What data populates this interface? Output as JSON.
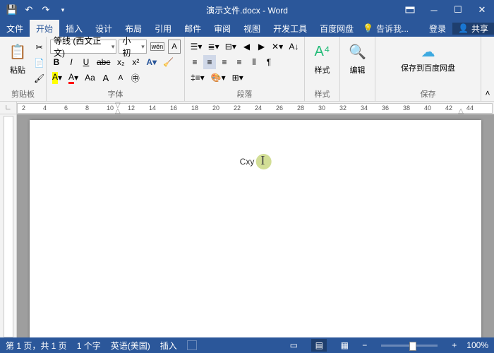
{
  "title": "演示文件.docx - Word",
  "tabs": {
    "file": "文件",
    "home": "开始",
    "insert": "插入",
    "design": "设计",
    "layout": "布局",
    "ref": "引用",
    "mail": "邮件",
    "review": "审阅",
    "view": "视图",
    "dev": "开发工具",
    "baidu": "百度网盘",
    "tell": "告诉我...",
    "login": "登录",
    "share": "共享"
  },
  "ribbon": {
    "clipboard": {
      "label": "剪贴板",
      "paste": "粘贴"
    },
    "font": {
      "label": "字体",
      "family": "等线 (西文正文)",
      "size": "小初",
      "b": "B",
      "i": "I",
      "u": "U",
      "abc": "abc",
      "x2": "x₂",
      "x2s": "x²",
      "a1": "A",
      "aa": "Aa",
      "ap": "A",
      "am": "A",
      "wen": "wén"
    },
    "para": {
      "label": "段落"
    },
    "styles": {
      "label": "样式",
      "btn": "样式"
    },
    "edit": {
      "label": "编辑",
      "btn": "编辑"
    },
    "save": {
      "label": "保存",
      "btn": "保存到百度网盘"
    }
  },
  "ruler": {
    "nums": [
      2,
      4,
      6,
      8,
      10,
      12,
      14,
      16,
      18,
      20,
      22,
      24,
      26,
      28,
      30,
      32,
      34,
      36,
      38,
      40,
      42,
      44
    ]
  },
  "doc": {
    "text": "Cxy"
  },
  "status": {
    "page": "第 1 页，共 1 页",
    "words": "1 个字",
    "lang": "英语(美国)",
    "mode": "插入",
    "zoom": "100%"
  }
}
